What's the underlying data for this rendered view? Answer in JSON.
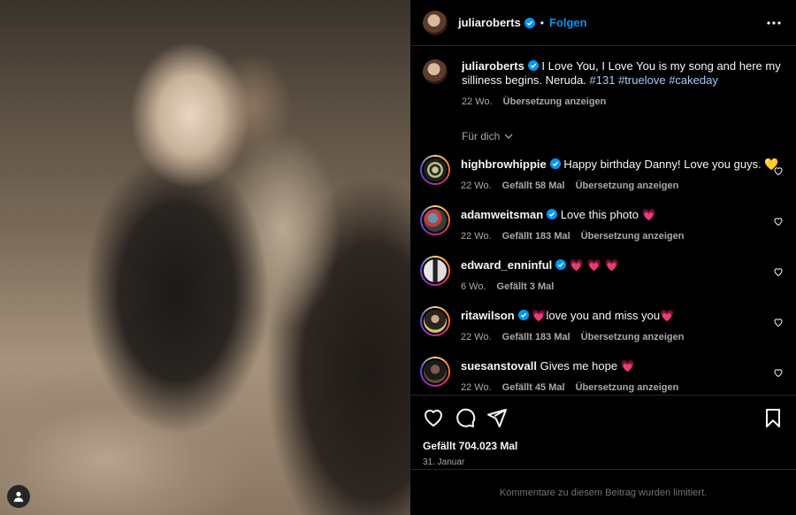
{
  "post": {
    "author": "juliaroberts",
    "follow_label": "Folgen",
    "dot": "•",
    "caption_text": "I Love You, I Love You is my song and here my silliness begins. Neruda. ",
    "hashtags": [
      "#131",
      "#truelove",
      "#cakeday"
    ],
    "caption_age": "22 Wo.",
    "translate_label": "Übersetzung anzeigen",
    "filter_label": "Für dich",
    "likes": "Gefällt 704.023 Mal",
    "date": "31. Januar",
    "comments_limited": "Kommentare zu diesem Beitrag wurden limitiert."
  },
  "comments": [
    {
      "user": "highbrowhippie",
      "text": "Happy birthday Danny! Love you guys. 💛",
      "age": "22 Wo.",
      "likes": "Gefällt 58 Mal",
      "translate": "Übersetzung anzeigen"
    },
    {
      "user": "adamweitsman",
      "text": "Love this photo 💗",
      "age": "22 Wo.",
      "likes": "Gefällt 183 Mal",
      "translate": "Übersetzung anzeigen"
    },
    {
      "user": "edward_enninful",
      "text": "💗 💗 💗",
      "age": "6 Wo.",
      "likes": "Gefällt 3 Mal",
      "translate": ""
    },
    {
      "user": "ritawilson",
      "text": "💗love you and miss you💗",
      "age": "22 Wo.",
      "likes": "Gefällt 183 Mal",
      "translate": "Übersetzung anzeigen"
    },
    {
      "user": "suesanstovall",
      "text": "Gives me hope 💗",
      "age": "22 Wo.",
      "likes": "Gefällt 45 Mal",
      "translate": "Übersetzung anzeigen"
    }
  ],
  "colors": {
    "accent": "#0095f6",
    "hashtag": "#a8c7fa",
    "muted": "#a8a8a8",
    "background": "#000000"
  },
  "icons": [
    "verified-icon",
    "more-options-icon",
    "heart-icon",
    "comment-icon",
    "share-icon",
    "bookmark-icon",
    "chevron-down-icon",
    "user-tag-icon"
  ]
}
